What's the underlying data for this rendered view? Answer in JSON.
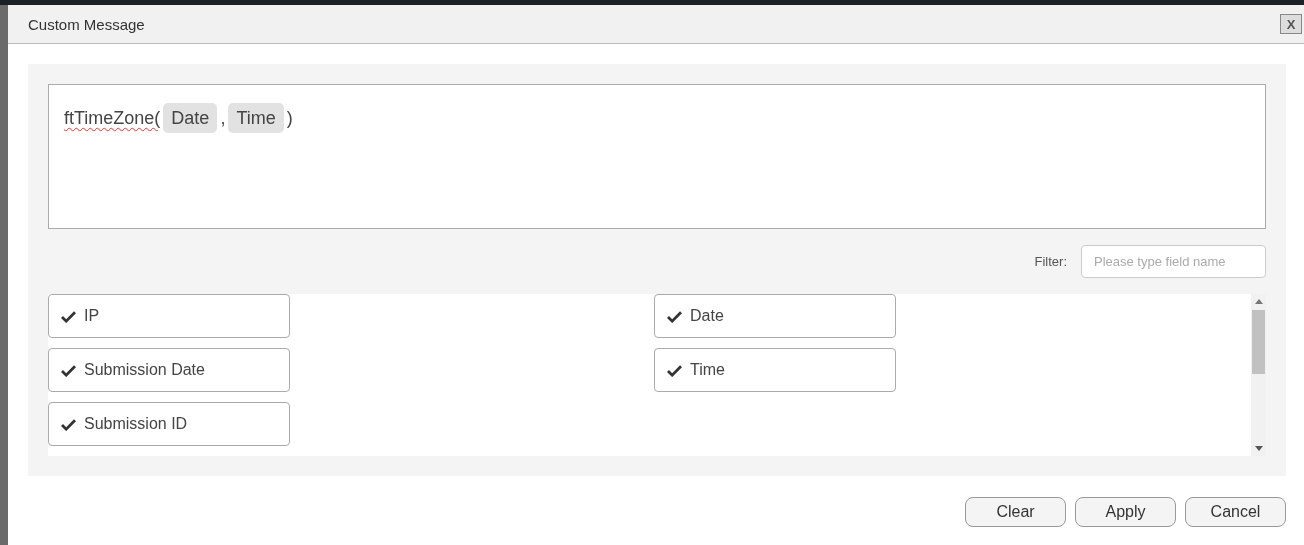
{
  "dialog": {
    "title": "Custom Message",
    "close_label": "X"
  },
  "editor": {
    "parts": [
      {
        "kind": "text",
        "text": "ftTimeZone(",
        "misspelled": true
      },
      {
        "kind": "token",
        "text": "Date"
      },
      {
        "kind": "text",
        "text": ",",
        "misspelled": false
      },
      {
        "kind": "token",
        "text": "Time"
      },
      {
        "kind": "text",
        "text": ")",
        "misspelled": false
      }
    ]
  },
  "filter": {
    "label": "Filter:",
    "placeholder": "Please type field name"
  },
  "fields": [
    {
      "label": "IP",
      "checked": true
    },
    {
      "label": "Date",
      "checked": true
    },
    {
      "label": "Submission Date",
      "checked": true
    },
    {
      "label": "Time",
      "checked": true
    },
    {
      "label": "Submission ID",
      "checked": true
    }
  ],
  "buttons": [
    "Clear",
    "Apply",
    "Cancel"
  ]
}
